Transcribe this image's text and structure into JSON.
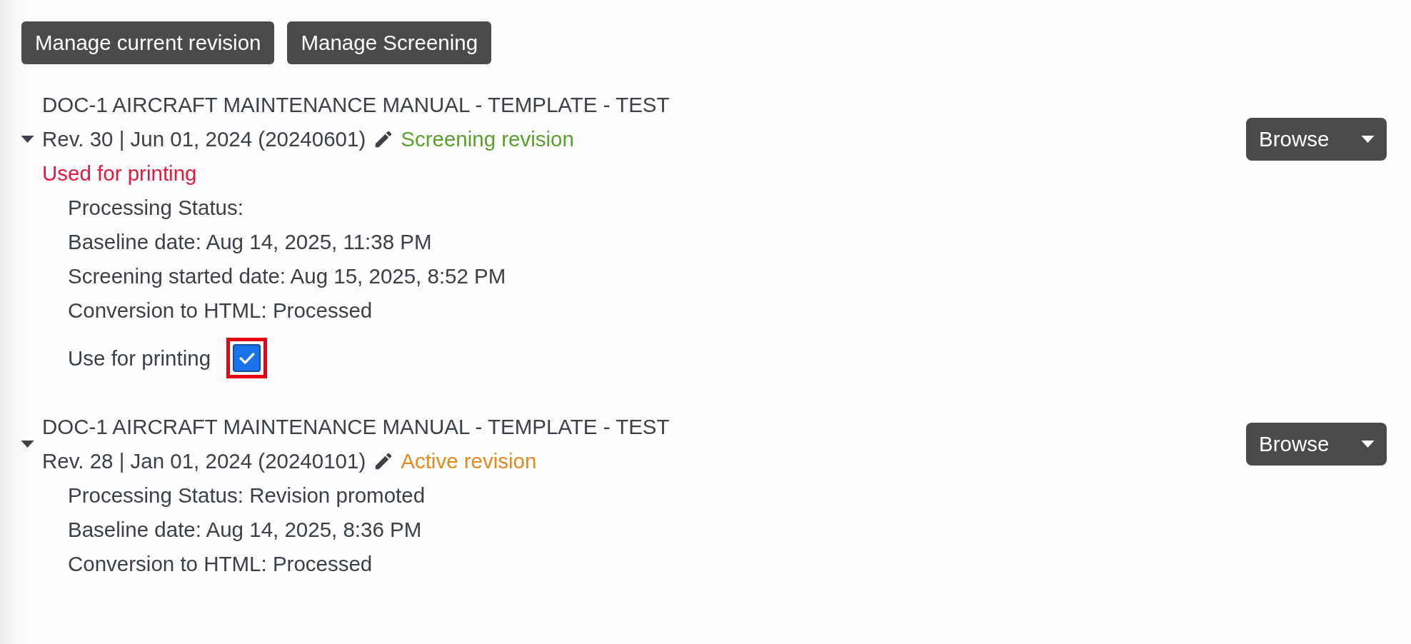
{
  "toolbar": [
    {
      "label": "Manage current revision"
    },
    {
      "label": "Manage Screening"
    }
  ],
  "revisions": [
    {
      "title": "DOC-1 AIRCRAFT MAINTENANCE MANUAL - TEMPLATE - TEST",
      "expanded": true,
      "revision": "Rev. 30 | Jun 01, 2024 (20240601)",
      "status": {
        "kind": "screening",
        "label": "Screening revision"
      },
      "print_note": "Used for printing",
      "details": [
        "Processing Status:",
        "Baseline date: Aug 14, 2025, 11:38 PM",
        "Screening started date: Aug 15, 2025, 8:52 PM",
        "Conversion to HTML: Processed"
      ],
      "print_option": {
        "label": "Use for printing",
        "checked": true,
        "highlighted": true
      },
      "browse": "Browse"
    },
    {
      "title": "DOC-1 AIRCRAFT MAINTENANCE MANUAL - TEMPLATE - TEST",
      "expanded": true,
      "revision": "Rev. 28 | Jan 01, 2024 (20240101)",
      "status": {
        "kind": "active",
        "label": "Active revision"
      },
      "details": [
        "Processing Status: Revision promoted",
        "Baseline date: Aug 14, 2025, 8:36 PM",
        "Conversion to HTML: Processed"
      ],
      "browse": "Browse"
    }
  ]
}
